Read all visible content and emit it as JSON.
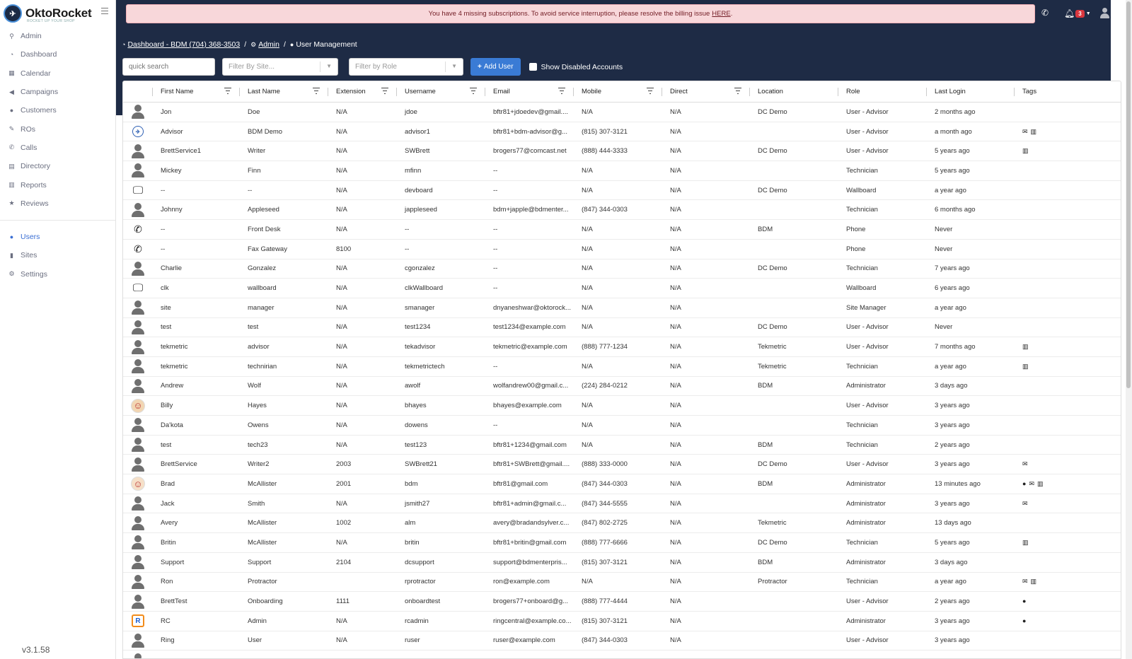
{
  "app": {
    "name": "OktoRocket",
    "tagline": "ROCKET UP YOUR SHOP",
    "version": "v3.1.58"
  },
  "sidebar": {
    "items": [
      {
        "label": "Admin",
        "icon": "key-icon",
        "glyph": "⚲"
      },
      {
        "label": "Dashboard",
        "icon": "dashboard-icon",
        "glyph": "◔"
      },
      {
        "label": "Calendar",
        "icon": "calendar-icon",
        "glyph": "▦"
      },
      {
        "label": "Campaigns",
        "icon": "bullhorn-icon",
        "glyph": "◀"
      },
      {
        "label": "Customers",
        "icon": "users-icon",
        "glyph": "●"
      },
      {
        "label": "ROs",
        "icon": "wrench-icon",
        "glyph": "✎"
      },
      {
        "label": "Calls",
        "icon": "phone-icon",
        "glyph": "✆"
      },
      {
        "label": "Directory",
        "icon": "book-icon",
        "glyph": "▤"
      },
      {
        "label": "Reports",
        "icon": "chart-icon",
        "glyph": "▥"
      },
      {
        "label": "Reviews",
        "icon": "star-icon",
        "glyph": "★"
      }
    ],
    "items2": [
      {
        "label": "Users",
        "icon": "users-icon",
        "glyph": "●",
        "active": true
      },
      {
        "label": "Sites",
        "icon": "building-icon",
        "glyph": "▮"
      },
      {
        "label": "Settings",
        "icon": "gear-icon",
        "glyph": "⚙"
      }
    ]
  },
  "alert": {
    "message": "You have 4 missing subscriptions. To avoid service interruption, please resolve the billing issue",
    "link": "HERE",
    "suffix": "."
  },
  "header": {
    "notification_count": "3"
  },
  "breadcrumb": {
    "dashboard": "Dashboard - BDM (704) 368-3503",
    "admin": "Admin",
    "current": "User Management"
  },
  "toolbar": {
    "search_placeholder": "quick search",
    "site_filter_placeholder": "Filter By Site...",
    "role_filter_placeholder": "Filter by Role",
    "add_user_label": "Add User",
    "show_disabled_label": "Show Disabled Accounts"
  },
  "table": {
    "columns": [
      "First Name",
      "Last Name",
      "Extension",
      "Username",
      "Email",
      "Mobile",
      "Direct",
      "Location",
      "Role",
      "Last Login",
      "Tags"
    ],
    "rows": [
      {
        "avatar": "person",
        "first": "Jon",
        "last": "Doe",
        "ext": "N/A",
        "user": "jdoe",
        "email": "bftr81+jdoedev@gmail....",
        "mobile": "N/A",
        "direct": "N/A",
        "location": "DC Demo",
        "role": "User - Advisor",
        "login": "2 months ago",
        "tags": []
      },
      {
        "avatar": "logo",
        "first": "Advisor",
        "last": "BDM Demo",
        "ext": "N/A",
        "user": "advisor1",
        "email": "bftr81+bdm-advisor@g...",
        "mobile": "(815) 307-3121",
        "direct": "N/A",
        "location": "",
        "role": "User - Advisor",
        "login": "a month ago",
        "tags": [
          "envelope",
          "map"
        ]
      },
      {
        "avatar": "person",
        "first": "BrettService1",
        "last": "Writer",
        "ext": "N/A",
        "user": "SWBrett",
        "email": "brogers77@comcast.net",
        "mobile": "(888) 444-3333",
        "direct": "N/A",
        "location": "DC Demo",
        "role": "User - Advisor",
        "login": "5 years ago",
        "tags": [
          "map"
        ]
      },
      {
        "avatar": "person",
        "first": "Mickey",
        "last": "Finn",
        "ext": "N/A",
        "user": "mfinn",
        "email": "--",
        "mobile": "N/A",
        "direct": "N/A",
        "location": "",
        "role": "Technician",
        "login": "5 years ago",
        "tags": []
      },
      {
        "avatar": "monitor",
        "first": "--",
        "last": "--",
        "ext": "N/A",
        "user": "devboard",
        "email": "--",
        "mobile": "N/A",
        "direct": "N/A",
        "location": "DC Demo",
        "role": "Wallboard",
        "login": "a year ago",
        "tags": []
      },
      {
        "avatar": "person",
        "first": "Johnny",
        "last": "Appleseed",
        "ext": "N/A",
        "user": "jappleseed",
        "email": "bdm+japple@bdmenter...",
        "mobile": "(847) 344-0303",
        "direct": "N/A",
        "location": "",
        "role": "Technician",
        "login": "6 months ago",
        "tags": []
      },
      {
        "avatar": "phone",
        "first": "--",
        "last": "Front Desk",
        "ext": "N/A",
        "user": "--",
        "email": "--",
        "mobile": "N/A",
        "direct": "N/A",
        "location": "BDM",
        "role": "Phone",
        "login": "Never",
        "tags": []
      },
      {
        "avatar": "phone",
        "first": "--",
        "last": "Fax Gateway",
        "ext": "8100",
        "user": "--",
        "email": "--",
        "mobile": "N/A",
        "direct": "N/A",
        "location": "",
        "role": "Phone",
        "login": "Never",
        "tags": []
      },
      {
        "avatar": "person",
        "first": "Charlie",
        "last": "Gonzalez",
        "ext": "N/A",
        "user": "cgonzalez",
        "email": "--",
        "mobile": "N/A",
        "direct": "N/A",
        "location": "DC Demo",
        "role": "Technician",
        "login": "7 years ago",
        "tags": []
      },
      {
        "avatar": "monitor",
        "first": "clk",
        "last": "wallboard",
        "ext": "N/A",
        "user": "clkWallboard",
        "email": "--",
        "mobile": "N/A",
        "direct": "N/A",
        "location": "",
        "role": "Wallboard",
        "login": "6 years ago",
        "tags": []
      },
      {
        "avatar": "person",
        "first": "site",
        "last": "manager",
        "ext": "N/A",
        "user": "smanager",
        "email": "dnyaneshwar@oktorock...",
        "mobile": "N/A",
        "direct": "N/A",
        "location": "",
        "role": "Site Manager",
        "login": "a year ago",
        "tags": []
      },
      {
        "avatar": "person",
        "first": "test",
        "last": "test",
        "ext": "N/A",
        "user": "test1234",
        "email": "test1234@example.com",
        "mobile": "N/A",
        "direct": "N/A",
        "location": "DC Demo",
        "role": "User - Advisor",
        "login": "Never",
        "tags": []
      },
      {
        "avatar": "person",
        "first": "tekmetric",
        "last": "advisor",
        "ext": "N/A",
        "user": "tekadvisor",
        "email": "tekmetric@example.com",
        "mobile": "(888) 777-1234",
        "direct": "N/A",
        "location": "Tekmetric",
        "role": "User - Advisor",
        "login": "7 months ago",
        "tags": [
          "map"
        ]
      },
      {
        "avatar": "person",
        "first": "tekmetric",
        "last": "technirian",
        "ext": "N/A",
        "user": "tekmetrictech",
        "email": "--",
        "mobile": "N/A",
        "direct": "N/A",
        "location": "Tekmetric",
        "role": "Technician",
        "login": "a year ago",
        "tags": [
          "map"
        ]
      },
      {
        "avatar": "person",
        "first": "Andrew",
        "last": "Wolf",
        "ext": "N/A",
        "user": "awolf",
        "email": "wolfandrew00@gmail.c...",
        "mobile": "(224) 284-0212",
        "direct": "N/A",
        "location": "BDM",
        "role": "Administrator",
        "login": "3 days ago",
        "tags": []
      },
      {
        "avatar": "cartoon",
        "first": "Billy",
        "last": "Hayes",
        "ext": "N/A",
        "user": "bhayes",
        "email": "bhayes@example.com",
        "mobile": "N/A",
        "direct": "N/A",
        "location": "",
        "role": "User - Advisor",
        "login": "3 years ago",
        "tags": []
      },
      {
        "avatar": "person",
        "first": "Da'kota",
        "last": "Owens",
        "ext": "N/A",
        "user": "dowens",
        "email": "--",
        "mobile": "N/A",
        "direct": "N/A",
        "location": "",
        "role": "Technician",
        "login": "3 years ago",
        "tags": []
      },
      {
        "avatar": "person",
        "first": "test",
        "last": "tech23",
        "ext": "N/A",
        "user": "test123",
        "email": "bftr81+1234@gmail.com",
        "mobile": "N/A",
        "direct": "N/A",
        "location": "BDM",
        "role": "Technician",
        "login": "2 years ago",
        "tags": []
      },
      {
        "avatar": "person",
        "first": "BrettService",
        "last": "Writer2",
        "ext": "2003",
        "user": "SWBrett21",
        "email": "bftr81+SWBrett@gmail....",
        "mobile": "(888) 333-0000",
        "direct": "N/A",
        "location": "DC Demo",
        "role": "User - Advisor",
        "login": "3 years ago",
        "tags": [
          "envelope"
        ]
      },
      {
        "avatar": "cartoon2",
        "first": "Brad",
        "last": "McAllister",
        "ext": "2001",
        "user": "bdm",
        "email": "bftr81@gmail.com",
        "mobile": "(847) 344-0303",
        "direct": "N/A",
        "location": "BDM",
        "role": "Administrator",
        "login": "13 minutes ago",
        "tags": [
          "comment",
          "envelope",
          "map"
        ]
      },
      {
        "avatar": "person",
        "first": "Jack",
        "last": "Smith",
        "ext": "N/A",
        "user": "jsmith27",
        "email": "bftr81+admin@gmail.c...",
        "mobile": "(847) 344-5555",
        "direct": "N/A",
        "location": "",
        "role": "Administrator",
        "login": "3 years ago",
        "tags": [
          "envelope"
        ]
      },
      {
        "avatar": "person",
        "first": "Avery",
        "last": "McAllister",
        "ext": "1002",
        "user": "alm",
        "email": "avery@bradandsylver.c...",
        "mobile": "(847) 802-2725",
        "direct": "N/A",
        "location": "Tekmetric",
        "role": "Administrator",
        "login": "13 days ago",
        "tags": []
      },
      {
        "avatar": "person",
        "first": "Britin",
        "last": "McAllister",
        "ext": "N/A",
        "user": "britin",
        "email": "bftr81+britin@gmail.com",
        "mobile": "(888) 777-6666",
        "direct": "N/A",
        "location": "DC Demo",
        "role": "Technician",
        "login": "5 years ago",
        "tags": [
          "map"
        ]
      },
      {
        "avatar": "person",
        "first": "Support",
        "last": "Support",
        "ext": "2104",
        "user": "dcsupport",
        "email": "support@bdmenterpris...",
        "mobile": "(815) 307-3121",
        "direct": "N/A",
        "location": "BDM",
        "role": "Administrator",
        "login": "3 days ago",
        "tags": []
      },
      {
        "avatar": "person",
        "first": "Ron",
        "last": "Protractor",
        "ext": "",
        "user": "rprotractor",
        "email": "ron@example.com",
        "mobile": "N/A",
        "direct": "N/A",
        "location": "Protractor",
        "role": "Technician",
        "login": "a year ago",
        "tags": [
          "envelope",
          "map"
        ]
      },
      {
        "avatar": "person",
        "first": "BrettTest",
        "last": "Onboarding",
        "ext": "1111",
        "user": "onboardtest",
        "email": "brogers77+onboard@g...",
        "mobile": "(888) 777-4444",
        "direct": "N/A",
        "location": "",
        "role": "User - Advisor",
        "login": "2 years ago",
        "tags": [
          "comment"
        ]
      },
      {
        "avatar": "rc",
        "first": "RC",
        "last": "Admin",
        "ext": "N/A",
        "user": "rcadmin",
        "email": "ringcentral@example.co...",
        "mobile": "(815) 307-3121",
        "direct": "N/A",
        "location": "",
        "role": "Administrator",
        "login": "3 years ago",
        "tags": [
          "comment"
        ]
      },
      {
        "avatar": "person",
        "first": "Ring",
        "last": "User",
        "ext": "N/A",
        "user": "ruser",
        "email": "ruser@example.com",
        "mobile": "(847) 344-0303",
        "direct": "N/A",
        "location": "",
        "role": "User - Advisor",
        "login": "3 years ago",
        "tags": []
      },
      {
        "avatar": "person",
        "first": "",
        "last": "",
        "ext": "",
        "user": "",
        "email": "",
        "mobile": "",
        "direct": "",
        "location": "",
        "role": "",
        "login": "",
        "tags": []
      }
    ]
  }
}
